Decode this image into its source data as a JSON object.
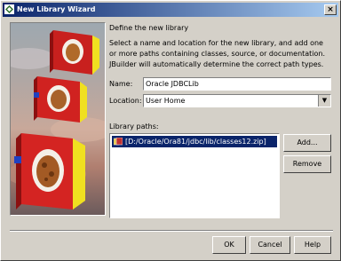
{
  "window": {
    "title": "New Library Wizard",
    "close_label": "×"
  },
  "page": {
    "heading": "Define the new library",
    "description": "Select a name and location for the new library, and add one or more paths containing classes, source, or documentation. JBuilder will automatically determine the correct path types."
  },
  "form": {
    "name_label": "Name:",
    "name_value": "Oracle JDBCLib",
    "location_label": "Location:",
    "location_value": "User Home",
    "paths_label": "Library paths:",
    "paths": [
      "[D:/Oracle/Ora81/jdbc/lib/classes12.zip]"
    ]
  },
  "side_buttons": {
    "add": "Add...",
    "remove": "Remove"
  },
  "footer_buttons": {
    "ok": "OK",
    "cancel": "Cancel",
    "help": "Help"
  }
}
